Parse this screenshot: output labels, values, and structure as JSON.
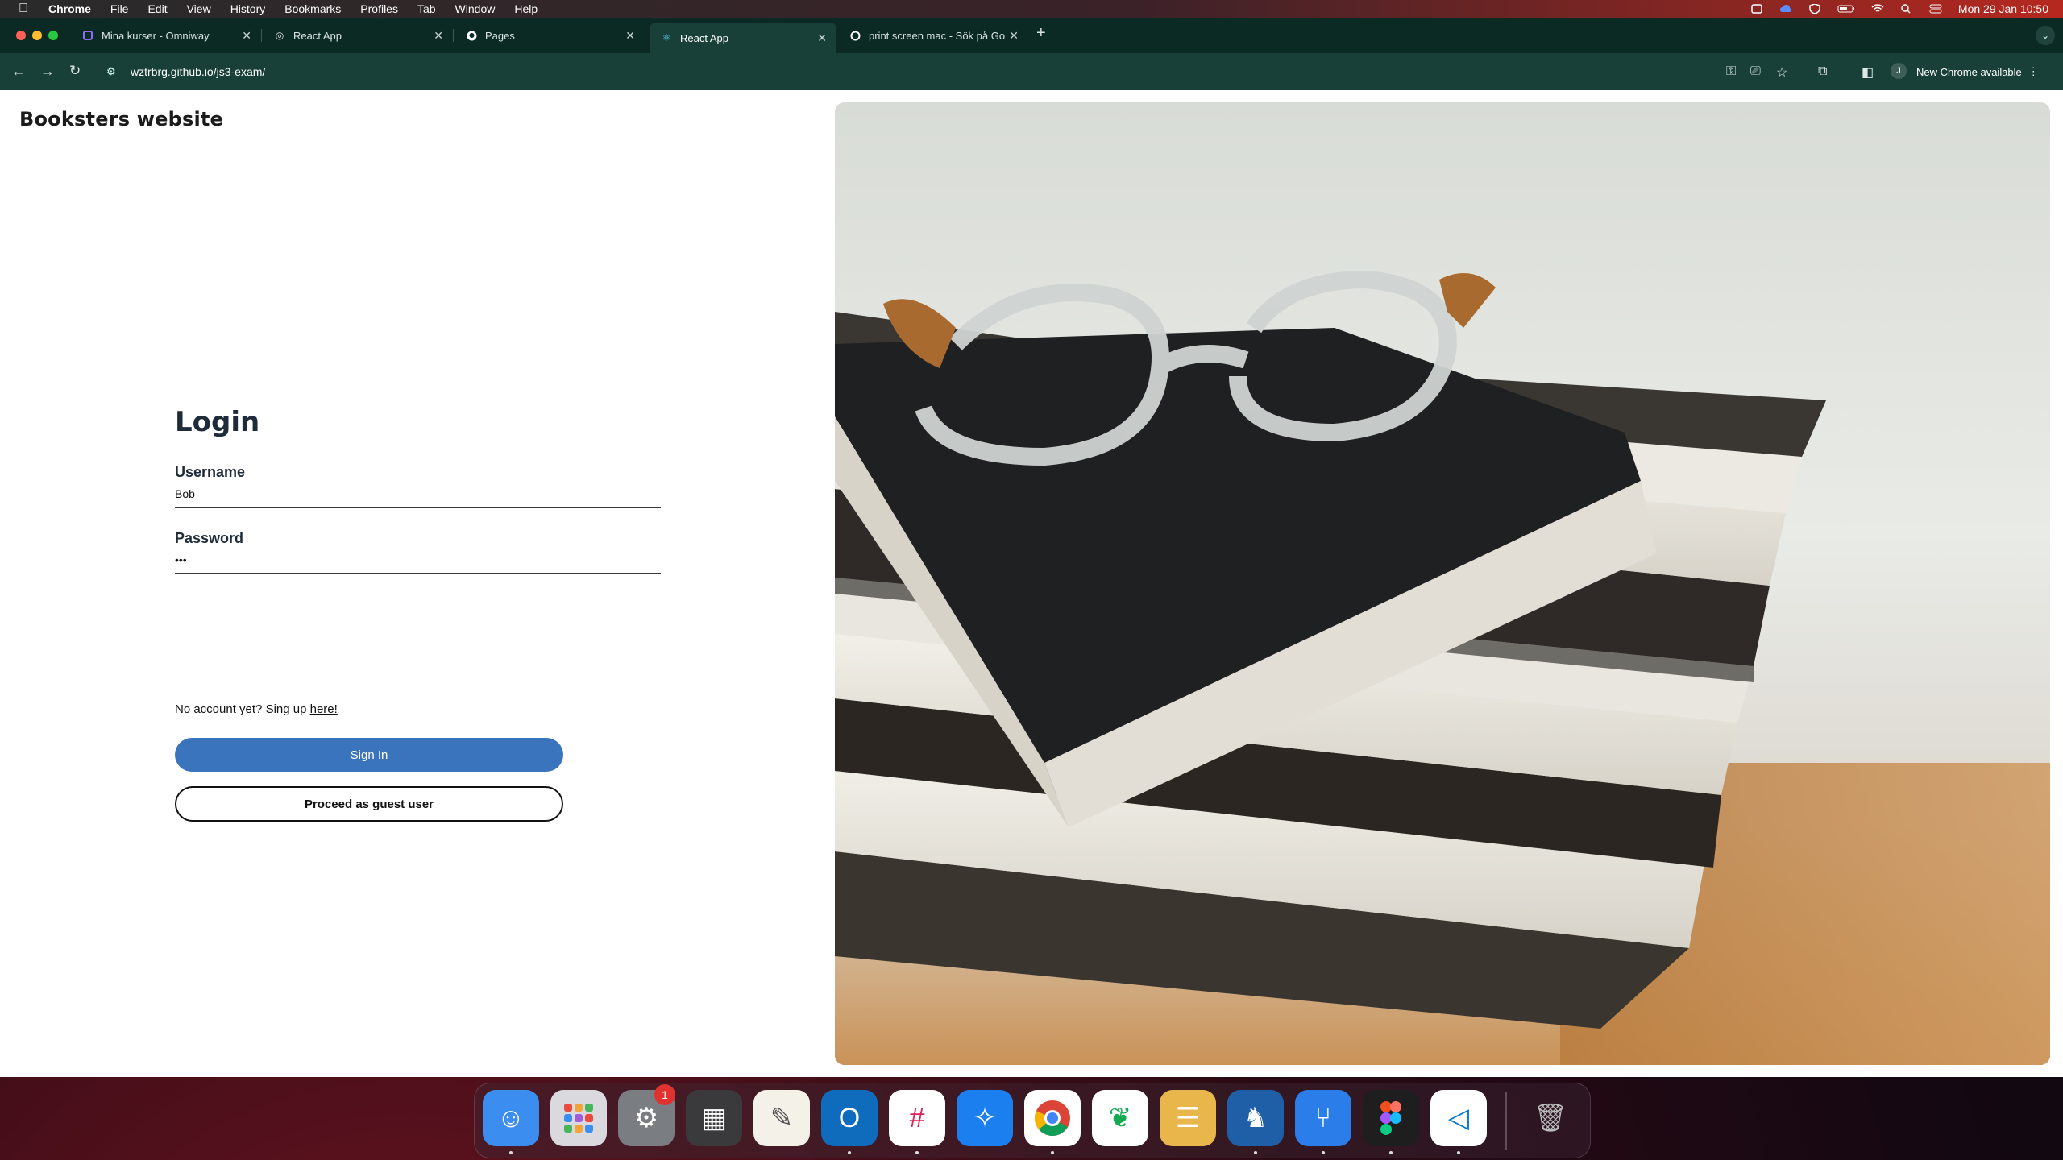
{
  "menubar": {
    "app": "Chrome",
    "menus": [
      "File",
      "Edit",
      "View",
      "History",
      "Bookmarks",
      "Profiles",
      "Tab",
      "Window",
      "Help"
    ],
    "datetime": "Mon 29 Jan 10:50"
  },
  "tabs": [
    {
      "title": "Mina kurser - Omniway",
      "active": false
    },
    {
      "title": "React App",
      "active": false
    },
    {
      "title": "Pages",
      "active": false
    },
    {
      "title": "React App",
      "active": true
    },
    {
      "title": "print screen mac - Sök på Go",
      "active": false
    }
  ],
  "toolbar": {
    "url": "wztrbrg.github.io/js3-exam/",
    "avatar_initial": "J",
    "update_label": "New Chrome available"
  },
  "page": {
    "brand": "Booksters website",
    "login": {
      "title": "Login",
      "username_label": "Username",
      "username_value": "Bob",
      "password_label": "Password",
      "password_value": "•••",
      "signup_text": "No account yet? Sing up",
      "signup_link": "here!",
      "signin_label": "Sign In",
      "guest_label": "Proceed as guest user"
    }
  },
  "dock": {
    "apps": [
      "finder",
      "launchpad",
      "system-settings",
      "calculator",
      "textedit",
      "outlook",
      "slack",
      "safari",
      "chrome",
      "mongodb-compass",
      "sequel",
      "tableplus",
      "fork",
      "figma",
      "vscode",
      "trash"
    ],
    "settings_badge": "1"
  },
  "colors": {
    "primary_button": "#3a74bd",
    "chrome_frame": "#0b2a24",
    "chrome_toolbar": "#184038"
  }
}
